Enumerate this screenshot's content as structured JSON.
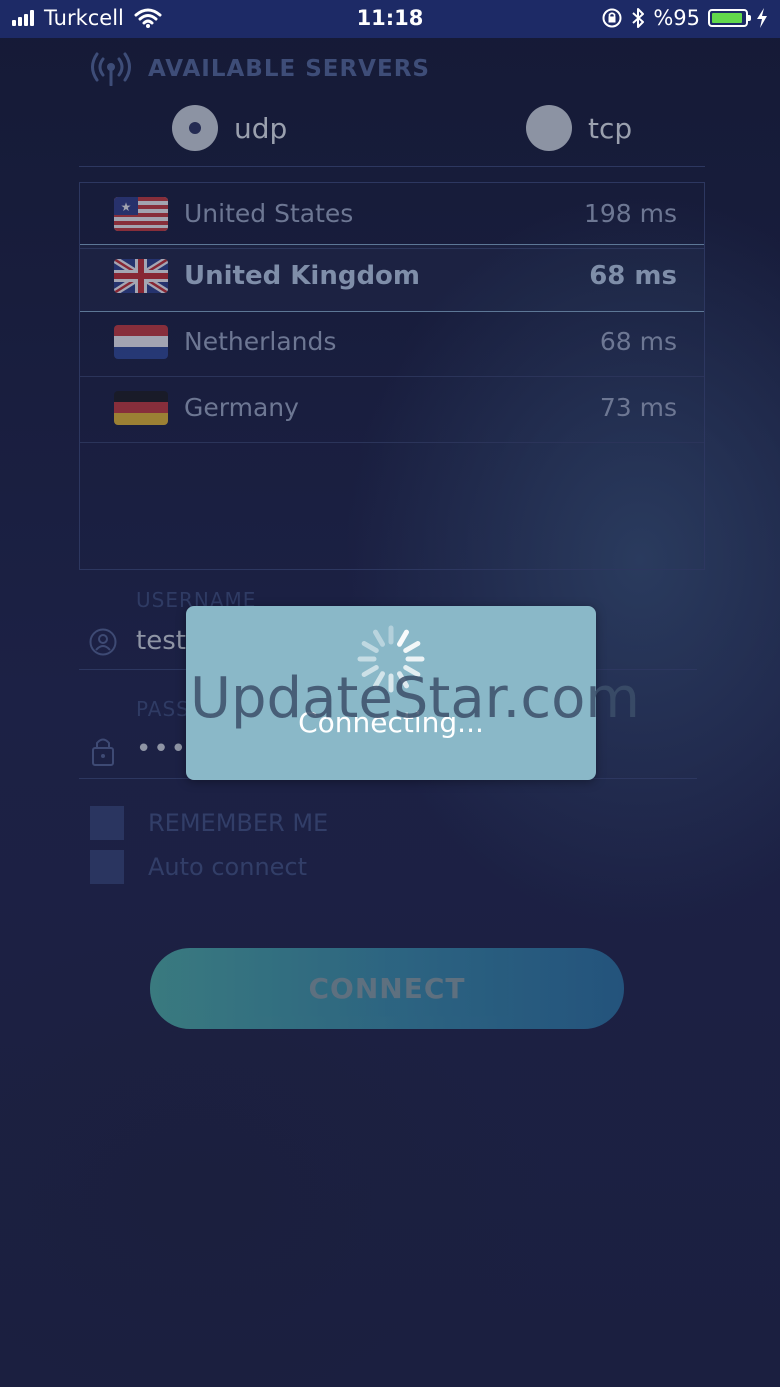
{
  "status_bar": {
    "carrier": "Turkcell",
    "time": "11:18",
    "battery_text": "%95",
    "battery_level": 0.95,
    "battery_color": "#62d84c"
  },
  "servers_panel": {
    "title": "AVAILABLE SERVERS",
    "protocols": [
      {
        "label": "udp",
        "selected": true
      },
      {
        "label": "tcp",
        "selected": false
      }
    ],
    "servers": [
      {
        "name": "United States",
        "ping": "198 ms",
        "flag": "us-flag-icon",
        "selected": false
      },
      {
        "name": "United Kingdom",
        "ping": "68 ms",
        "flag": "uk-flag-icon",
        "selected": true
      },
      {
        "name": "Netherlands",
        "ping": "68 ms",
        "flag": "nl-flag-icon",
        "selected": false
      },
      {
        "name": "Germany",
        "ping": "73 ms",
        "flag": "de-flag-icon",
        "selected": false
      }
    ]
  },
  "login": {
    "username_label": "USERNAME",
    "username_value": "test",
    "password_label": "PASSWORD",
    "password_value": "••••",
    "remember_me": "REMEMBER ME",
    "auto_connect": "Auto connect",
    "connect_label": "CONNECT"
  },
  "hud": {
    "message": "Connecting...",
    "watermark": "UpdateStar.com"
  }
}
